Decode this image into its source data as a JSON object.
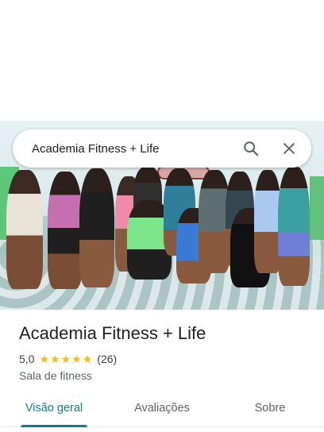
{
  "search": {
    "query": "Academia Fitness + Life",
    "search_icon": "search-icon",
    "close_icon": "close-icon"
  },
  "photo": {
    "subject": "group-photo"
  },
  "place": {
    "name": "Academia Fitness + Life",
    "rating": "5,0",
    "stars": 5,
    "review_count": "(26)",
    "category": "Sala de fitness"
  },
  "tabs": [
    {
      "label": "Visão geral",
      "active": true
    },
    {
      "label": "Avaliações",
      "active": false
    },
    {
      "label": "Sobre",
      "active": false
    }
  ],
  "colors": {
    "accent": "#0b7f8b",
    "star": "#fbbc04",
    "text_primary": "#202124",
    "text_secondary": "#5f6368"
  }
}
